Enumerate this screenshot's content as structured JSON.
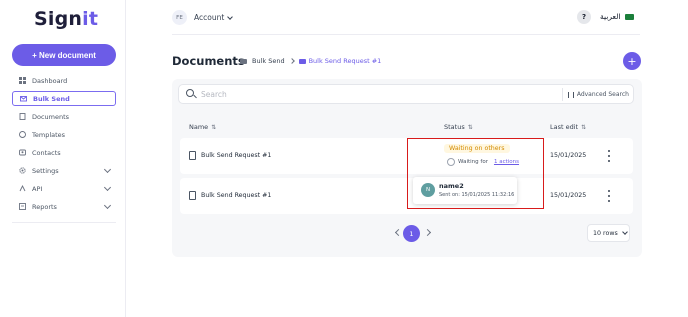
{
  "app": {
    "logo_main": "Sign",
    "logo_accent": "it"
  },
  "sidebar": {
    "new_document_label": "+ New document",
    "items": [
      {
        "label": "Dashboard",
        "icon": "grid-icon"
      },
      {
        "label": "Bulk Send",
        "icon": "envelopes-icon",
        "active": true
      },
      {
        "label": "Documents",
        "icon": "documents-icon"
      },
      {
        "label": "Templates",
        "icon": "template-icon"
      },
      {
        "label": "Contacts",
        "icon": "contacts-icon"
      },
      {
        "label": "Settings",
        "icon": "gear-icon",
        "expandable": true
      },
      {
        "label": "API",
        "icon": "api-icon",
        "expandable": true
      },
      {
        "label": "Reports",
        "icon": "reports-icon",
        "expandable": true
      }
    ]
  },
  "header": {
    "avatar_initials": "FE",
    "account_label": "Account",
    "help_label": "?",
    "language_label": "العربية"
  },
  "page": {
    "title": "Documents",
    "breadcrumb": [
      "Bulk Send",
      "Bulk Send Request #1"
    ]
  },
  "search": {
    "placeholder": "Search",
    "advanced_label": "Advanced Search"
  },
  "table": {
    "columns": [
      "Name",
      "Status",
      "Last edit"
    ],
    "rows": [
      {
        "name": "Bulk Send Request #1",
        "status": "Waiting on others",
        "waiting_for": "Waiting for",
        "actions": "1 actions",
        "last_edit": "15/01/2025"
      },
      {
        "name": "Bulk Send Request #1",
        "last_edit": "15/01/2025"
      }
    ]
  },
  "popover": {
    "avatar_initial": "N",
    "name": "name2",
    "sent": "Sent on: 15/01/2025 11:32:16"
  },
  "pagination": {
    "current_page": "1",
    "rows_per_page": "10 rows"
  },
  "colors": {
    "accent": "#6c5ce7",
    "status_waiting": "#d38b00",
    "highlight": "#d81b1b"
  }
}
